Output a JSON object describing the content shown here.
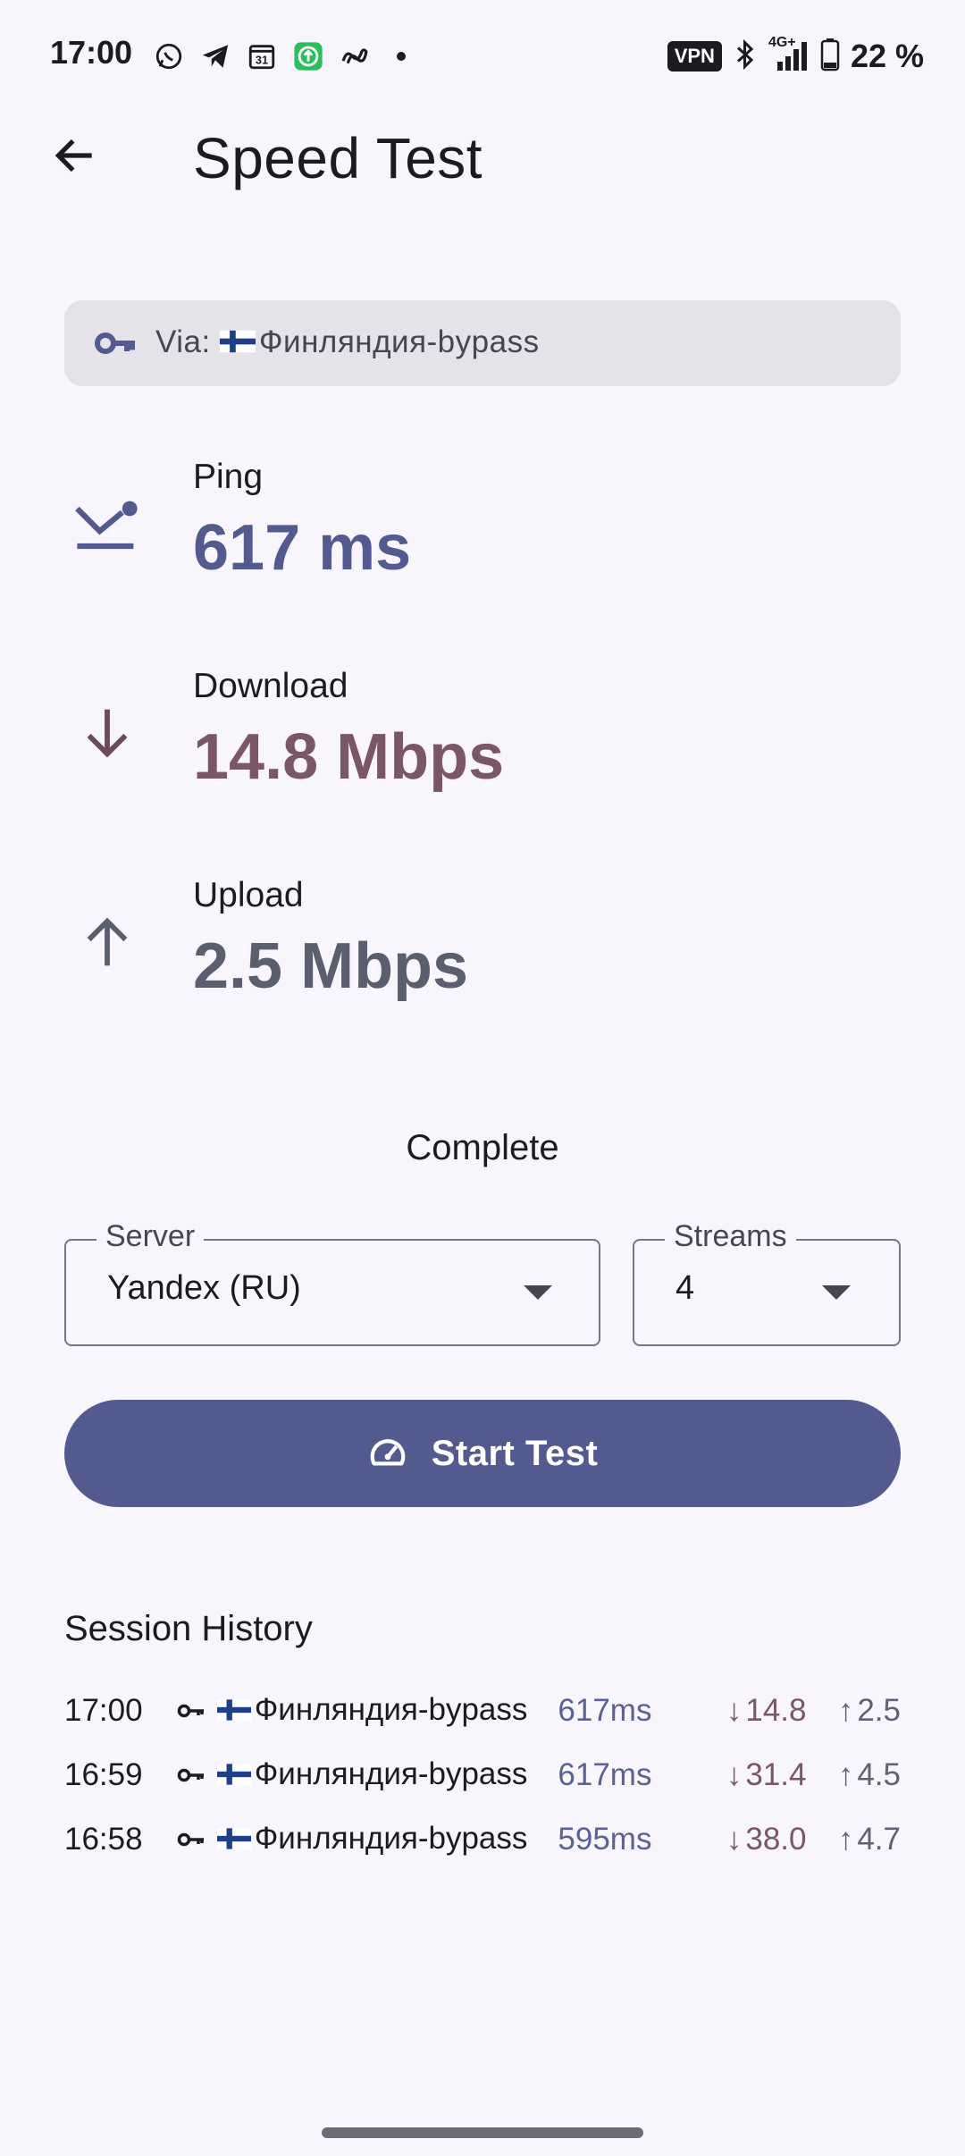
{
  "status_bar": {
    "time": "17:00",
    "left_icons": [
      "whatsapp-icon",
      "telegram-icon",
      "calendar-icon",
      "upload-app-icon",
      "infinity-icon",
      "dot-icon"
    ],
    "calendar_day": "31",
    "vpn_label": "VPN",
    "network": "4G+",
    "battery": "22 %"
  },
  "app_bar": {
    "title": "Speed Test"
  },
  "via": {
    "prefix": "Via: ",
    "server": "Финляндия-bypass"
  },
  "metrics": {
    "ping": {
      "label": "Ping",
      "value": "617 ms"
    },
    "download": {
      "label": "Download",
      "value": "14.8 Mbps"
    },
    "upload": {
      "label": "Upload",
      "value": "2.5 Mbps"
    }
  },
  "status_text": "Complete",
  "server_select": {
    "label": "Server",
    "value": "Yandex (RU)"
  },
  "streams_select": {
    "label": "Streams",
    "value": "4"
  },
  "start_button": {
    "label": "Start Test"
  },
  "history": {
    "title": "Session History",
    "rows": [
      {
        "time": "17:00",
        "server": "Финляндия-bypass",
        "ping": "617ms",
        "down": "14.8",
        "up": "2.5"
      },
      {
        "time": "16:59",
        "server": "Финляндия-bypass",
        "ping": "617ms",
        "down": "31.4",
        "up": "4.5"
      },
      {
        "time": "16:58",
        "server": "Финляндия-bypass",
        "ping": "595ms",
        "down": "38.0",
        "up": "4.7"
      }
    ]
  },
  "colors": {
    "primary": "#525a8f",
    "ping_value": "#525a8f",
    "download_value": "#7a5667",
    "upload_value": "#5a5e6f",
    "background": "#f8f5fc",
    "chip_bg": "#e6e2ea"
  }
}
